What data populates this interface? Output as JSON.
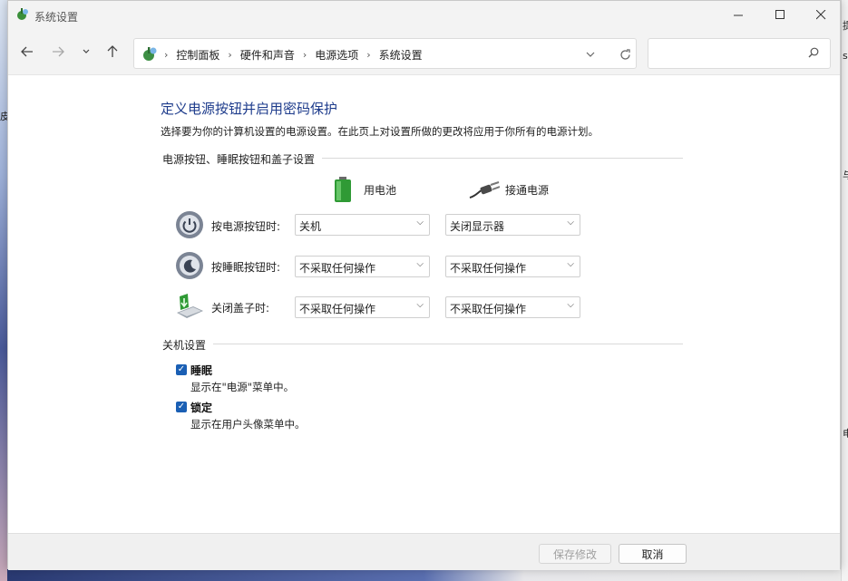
{
  "window": {
    "title": "系统设置"
  },
  "nav": {
    "back": "back-arrow",
    "forward": "forward-arrow",
    "recent": "chevron-down",
    "up": "up-arrow"
  },
  "breadcrumb": [
    "控制面板",
    "硬件和声音",
    "电源选项",
    "系统设置"
  ],
  "search": {
    "placeholder": ""
  },
  "page": {
    "heading": "定义电源按钮并启用密码保护",
    "description": "选择要为你的计算机设置的电源设置。在此页上对设置所做的更改将应用于你所有的电源计划。"
  },
  "power_section": {
    "title": "电源按钮、睡眠按钮和盖子设置",
    "columns": {
      "battery": "用电池",
      "plugged": "接通电源"
    },
    "rows": [
      {
        "label": "按电源按钮时:",
        "battery": "关机",
        "plugged": "关闭显示器"
      },
      {
        "label": "按睡眠按钮时:",
        "battery": "不采取任何操作",
        "plugged": "不采取任何操作"
      },
      {
        "label": "关闭盖子时:",
        "battery": "不采取任何操作",
        "plugged": "不采取任何操作"
      }
    ]
  },
  "shutdown_section": {
    "title": "关机设置",
    "options": [
      {
        "label": "睡眠",
        "description": "显示在\"电源\"菜单中。",
        "checked": true
      },
      {
        "label": "锁定",
        "description": "显示在用户头像菜单中。",
        "checked": true
      }
    ]
  },
  "footer": {
    "save": "保存修改",
    "cancel": "取消"
  },
  "background": {
    "right_fragments": [
      "提",
      "sc",
      "与",
      "电"
    ],
    "left_fragments": [
      "皮"
    ]
  },
  "colors": {
    "accent": "#1a5fb4",
    "heading": "#1e3c8c"
  }
}
